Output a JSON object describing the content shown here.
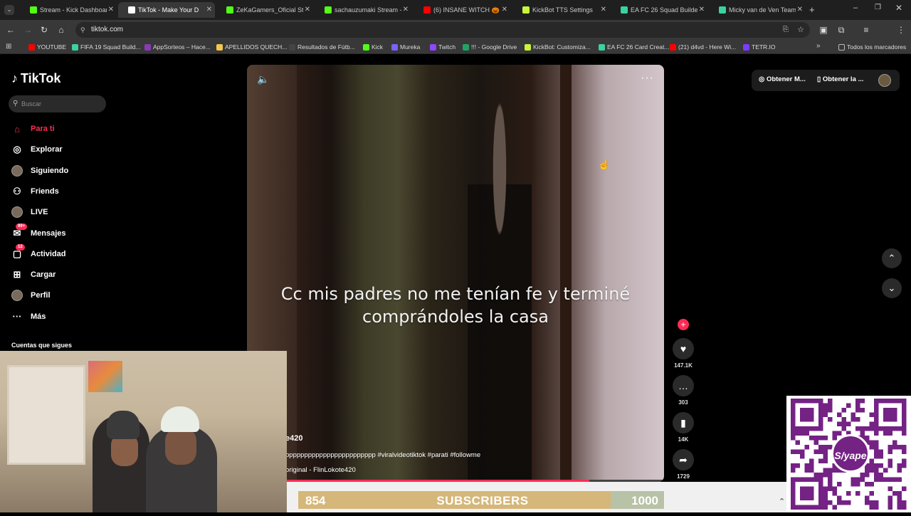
{
  "browser": {
    "tabs": [
      {
        "title": "Stream - Kick Dashboard",
        "color": "#53fc18"
      },
      {
        "title": "TikTok - Make Your D",
        "color": "#ffffff",
        "active": true
      },
      {
        "title": "ZeKaGamers_Oficial Strea",
        "color": "#53fc18"
      },
      {
        "title": "sachauzumaki Stream - W",
        "color": "#53fc18"
      },
      {
        "title": "(6) INSANE WITCH 🎃",
        "color": "#ff0000"
      },
      {
        "title": "KickBot TTS Settings",
        "color": "#c9f53a"
      },
      {
        "title": "EA FC 26 Squad Builder |",
        "color": "#3ad29f"
      },
      {
        "title": "Micky van de Ven Team c",
        "color": "#3ad29f"
      }
    ],
    "url": "tiktok.com",
    "bookmarks": [
      {
        "label": "YOUTUBE",
        "color": "#ff0000"
      },
      {
        "label": "FIFA 19 Squad Build...",
        "color": "#3ad29f"
      },
      {
        "label": "AppSorteos – Hace...",
        "color": "#8a3ab9"
      },
      {
        "label": "APELLIDOS QUECH...",
        "color": "#f2c94c"
      },
      {
        "label": "Resultados de Fútb...",
        "color": "#444444"
      },
      {
        "label": "Kick",
        "color": "#53fc18"
      },
      {
        "label": "Mureka",
        "color": "#7b61ff"
      },
      {
        "label": "Twitch",
        "color": "#9146ff"
      },
      {
        "label": "!!! - Google Drive",
        "color": "#1fa463"
      },
      {
        "label": "KickBot: Customiza...",
        "color": "#c9f53a"
      },
      {
        "label": "EA FC 26 Card Creat...",
        "color": "#3ad29f"
      },
      {
        "label": "(21) d4vd - Here Wi...",
        "color": "#ff0000"
      },
      {
        "label": "TETR.IO",
        "color": "#7a3cff"
      }
    ],
    "all_bookmarks_label": "Todos los marcadores"
  },
  "tiktok": {
    "brand": "TikTok",
    "search_placeholder": "Buscar",
    "nav": [
      {
        "label": "Para ti",
        "icon": "home-icon",
        "active": true
      },
      {
        "label": "Explorar",
        "icon": "compass-icon"
      },
      {
        "label": "Siguiendo",
        "icon": "following-avatar"
      },
      {
        "label": "Friends",
        "icon": "friends-icon"
      },
      {
        "label": "LIVE",
        "icon": "live-avatar"
      },
      {
        "label": "Mensajes",
        "icon": "messages-icon",
        "badge": "99+"
      },
      {
        "label": "Actividad",
        "icon": "activity-icon",
        "badge": "12"
      },
      {
        "label": "Cargar",
        "icon": "upload-icon"
      },
      {
        "label": "Perfil",
        "icon": "profile-avatar"
      },
      {
        "label": "Más",
        "icon": "more-icon"
      }
    ],
    "following_title": "Cuentas que sigues",
    "top_right": {
      "get_coins": "Obtener M...",
      "get_app": "Obtener la ..."
    },
    "video": {
      "caption": "Cc mis padres no me tenían fe y terminé comprándoles la casa",
      "author_fragment": "e420",
      "hashtags": "pppppppppppppppppppppppp #viralvideotiktok #parati #followme",
      "sound": "original - FlinLokote420",
      "progress": 0.82
    },
    "actions": {
      "likes": "147.1K",
      "comments": "303",
      "saves": "14K",
      "shares": "1729"
    }
  },
  "stream_overlay": {
    "subscribers_current": "854",
    "subscribers_label": "SUBSCRIBERS",
    "subscribers_goal": "1000",
    "subscribers_progress": 0.854,
    "qr_logo": "yape"
  }
}
